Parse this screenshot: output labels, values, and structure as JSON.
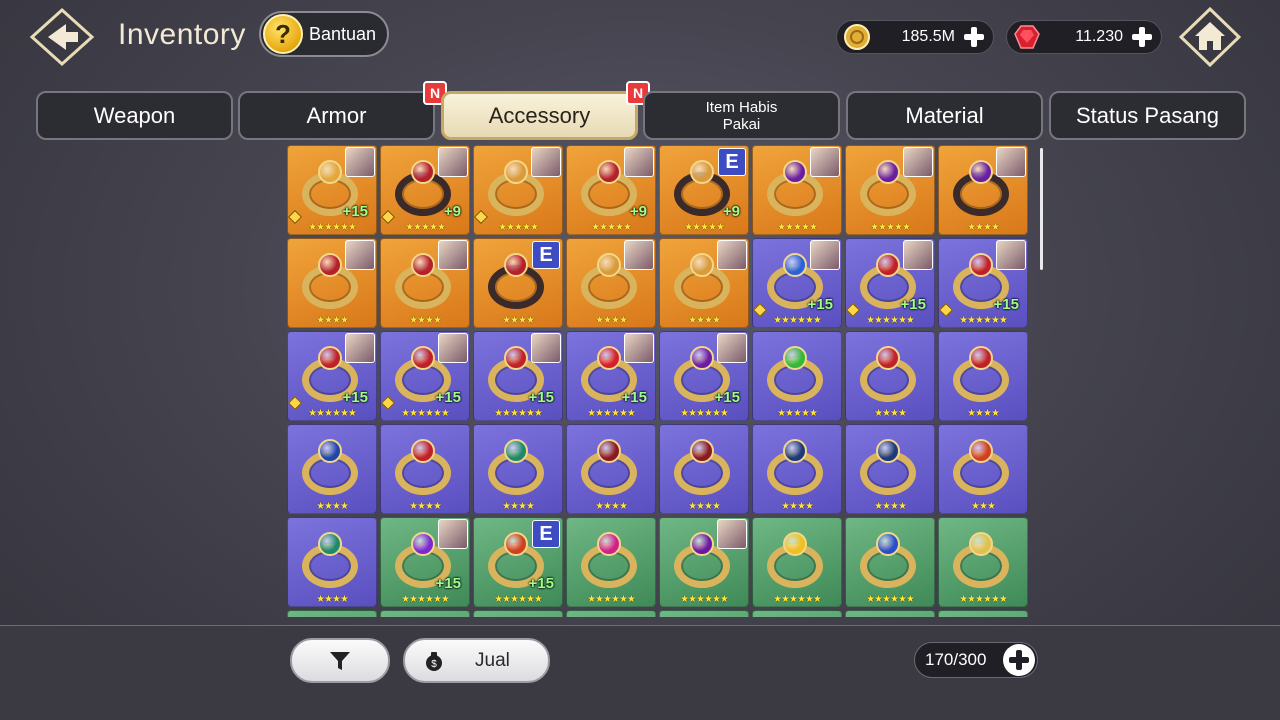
{
  "header": {
    "title": "Inventory",
    "help_label": "Bantuan",
    "help_symbol": "?",
    "gold_value": "185.5M",
    "gem_value": "11.230"
  },
  "tabs": [
    {
      "label": "Weapon",
      "active": false,
      "badge": ""
    },
    {
      "label": "Armor",
      "active": false,
      "badge": "N"
    },
    {
      "label": "Accessory",
      "active": true,
      "badge": "N"
    },
    {
      "label_line1": "Item Habis",
      "label_line2": "Pakai",
      "active": false,
      "badge": ""
    },
    {
      "label": "Material",
      "active": false,
      "badge": ""
    },
    {
      "label": "Status Pasang",
      "active": false,
      "badge": ""
    }
  ],
  "colors": {
    "rarity_orange": "#e08b26",
    "rarity_purple": "#6a62d2",
    "rarity_green": "#55a06e",
    "active_tab": "#f2ead0",
    "badge_red": "#e83a3a"
  },
  "items": [
    {
      "rarity": "orange",
      "gem": "#e2a83a",
      "mark": "avatar",
      "level": "+15",
      "stars": "★★★★★★",
      "lock": true
    },
    {
      "rarity": "orange",
      "gem": "#b5202a",
      "mark": "avatar",
      "level": "+9",
      "stars": "★★★★★",
      "lock": true
    },
    {
      "rarity": "orange",
      "gem": "#d99a3a",
      "mark": "avatar",
      "level": "",
      "stars": "★★★★★",
      "lock": true
    },
    {
      "rarity": "orange",
      "gem": "#b5202a",
      "mark": "avatar",
      "level": "+9",
      "stars": "★★★★★",
      "lock": false
    },
    {
      "rarity": "orange",
      "gem": "#d99a3a",
      "mark": "E",
      "level": "+9",
      "stars": "★★★★★",
      "lock": false
    },
    {
      "rarity": "orange",
      "gem": "#6b1fa0",
      "mark": "avatar",
      "level": "",
      "stars": "★★★★★",
      "lock": false
    },
    {
      "rarity": "orange",
      "gem": "#6b1fa0",
      "mark": "avatar",
      "level": "",
      "stars": "★★★★★",
      "lock": false
    },
    {
      "rarity": "orange",
      "gem": "#6b1fa0",
      "mark": "avatar",
      "level": "",
      "stars": "★★★★",
      "lock": false
    },
    {
      "rarity": "orange",
      "gem": "#b5202a",
      "mark": "avatar",
      "level": "",
      "stars": "★★★★",
      "lock": false
    },
    {
      "rarity": "orange",
      "gem": "#b5202a",
      "mark": "avatar",
      "level": "",
      "stars": "★★★★",
      "lock": false
    },
    {
      "rarity": "orange",
      "gem": "#b5202a",
      "mark": "E",
      "level": "",
      "stars": "★★★★",
      "lock": false
    },
    {
      "rarity": "orange",
      "gem": "#d99a3a",
      "mark": "avatar",
      "level": "",
      "stars": "★★★★",
      "lock": false
    },
    {
      "rarity": "orange",
      "gem": "#d99a3a",
      "mark": "avatar",
      "level": "",
      "stars": "★★★★",
      "lock": false
    },
    {
      "rarity": "purple",
      "gem": "#2a63d8",
      "mark": "avatar",
      "level": "+15",
      "stars": "★★★★★★",
      "lock": true
    },
    {
      "rarity": "purple",
      "gem": "#c02028",
      "mark": "avatar",
      "level": "+15",
      "stars": "★★★★★★",
      "lock": true
    },
    {
      "rarity": "purple",
      "gem": "#c02028",
      "mark": "avatar",
      "level": "+15",
      "stars": "★★★★★★",
      "lock": true
    },
    {
      "rarity": "purple",
      "gem": "#c02028",
      "mark": "avatar",
      "level": "+15",
      "stars": "★★★★★★",
      "lock": true
    },
    {
      "rarity": "purple",
      "gem": "#c02028",
      "mark": "avatar",
      "level": "+15",
      "stars": "★★★★★★",
      "lock": true
    },
    {
      "rarity": "purple",
      "gem": "#c02028",
      "mark": "avatar",
      "level": "+15",
      "stars": "★★★★★★",
      "lock": false
    },
    {
      "rarity": "purple",
      "gem": "#d4202a",
      "mark": "avatar",
      "level": "+15",
      "stars": "★★★★★★",
      "lock": false
    },
    {
      "rarity": "purple",
      "gem": "#6b1fa0",
      "mark": "avatar",
      "level": "+15",
      "stars": "★★★★★★",
      "lock": false
    },
    {
      "rarity": "purple",
      "gem": "#34b83a",
      "mark": "",
      "level": "",
      "stars": "★★★★★",
      "lock": false
    },
    {
      "rarity": "purple",
      "gem": "#c02028",
      "mark": "",
      "level": "",
      "stars": "★★★★",
      "lock": false
    },
    {
      "rarity": "purple",
      "gem": "#c02028",
      "mark": "",
      "level": "",
      "stars": "★★★★",
      "lock": false
    },
    {
      "rarity": "purple",
      "gem": "#2246a8",
      "mark": "",
      "level": "",
      "stars": "★★★★",
      "lock": false
    },
    {
      "rarity": "purple",
      "gem": "#c02028",
      "mark": "",
      "level": "",
      "stars": "★★★★",
      "lock": false
    },
    {
      "rarity": "purple",
      "gem": "#1e8a6a",
      "mark": "",
      "level": "",
      "stars": "★★★★",
      "lock": false
    },
    {
      "rarity": "purple",
      "gem": "#8a1a22",
      "mark": "",
      "level": "",
      "stars": "★★★★",
      "lock": false
    },
    {
      "rarity": "purple",
      "gem": "#8a1a22",
      "mark": "",
      "level": "",
      "stars": "★★★★",
      "lock": false
    },
    {
      "rarity": "purple",
      "gem": "#1f3a78",
      "mark": "",
      "level": "",
      "stars": "★★★★",
      "lock": false
    },
    {
      "rarity": "purple",
      "gem": "#1f3a78",
      "mark": "",
      "level": "",
      "stars": "★★★★",
      "lock": false
    },
    {
      "rarity": "purple",
      "gem": "#d04020",
      "mark": "",
      "level": "",
      "stars": "★★★",
      "lock": false
    },
    {
      "rarity": "purple",
      "gem": "#1e8a6a",
      "mark": "",
      "level": "",
      "stars": "★★★★",
      "lock": false
    },
    {
      "rarity": "green",
      "gem": "#7a2ad0",
      "mark": "avatar",
      "level": "+15",
      "stars": "★★★★★★",
      "lock": false
    },
    {
      "rarity": "green",
      "gem": "#d04020",
      "mark": "E",
      "level": "+15",
      "stars": "★★★★★★",
      "lock": false
    },
    {
      "rarity": "green",
      "gem": "#d0208a",
      "mark": "",
      "level": "",
      "stars": "★★★★★★",
      "lock": false
    },
    {
      "rarity": "green",
      "gem": "#6a1aa0",
      "mark": "avatar",
      "level": "",
      "stars": "★★★★★★",
      "lock": false
    },
    {
      "rarity": "green",
      "gem": "#f0c020",
      "mark": "",
      "level": "",
      "stars": "★★★★★★",
      "lock": false
    },
    {
      "rarity": "green",
      "gem": "#2a50c8",
      "mark": "",
      "level": "",
      "stars": "★★★★★★",
      "lock": false
    },
    {
      "rarity": "green",
      "gem": "#e0c050",
      "mark": "",
      "level": "",
      "stars": "★★★★★★",
      "lock": false
    },
    {
      "rarity": "green",
      "gem": "#888888",
      "mark": "",
      "level": "",
      "stars": "",
      "lock": false
    },
    {
      "rarity": "green",
      "gem": "#888888",
      "mark": "",
      "level": "",
      "stars": "",
      "lock": false
    },
    {
      "rarity": "green",
      "gem": "#888888",
      "mark": "",
      "level": "",
      "stars": "",
      "lock": false
    },
    {
      "rarity": "green",
      "gem": "#888888",
      "mark": "",
      "level": "",
      "stars": "",
      "lock": false
    },
    {
      "rarity": "green",
      "gem": "#888888",
      "mark": "",
      "level": "",
      "stars": "",
      "lock": false
    },
    {
      "rarity": "green",
      "gem": "#888888",
      "mark": "",
      "level": "",
      "stars": "",
      "lock": false
    },
    {
      "rarity": "green",
      "gem": "#888888",
      "mark": "",
      "level": "",
      "stars": "",
      "lock": false
    },
    {
      "rarity": "green",
      "gem": "#888888",
      "mark": "",
      "level": "",
      "stars": "",
      "lock": false
    }
  ],
  "footer": {
    "filter_icon": "filter-icon",
    "sell_label": "Jual",
    "capacity": "170/300"
  }
}
